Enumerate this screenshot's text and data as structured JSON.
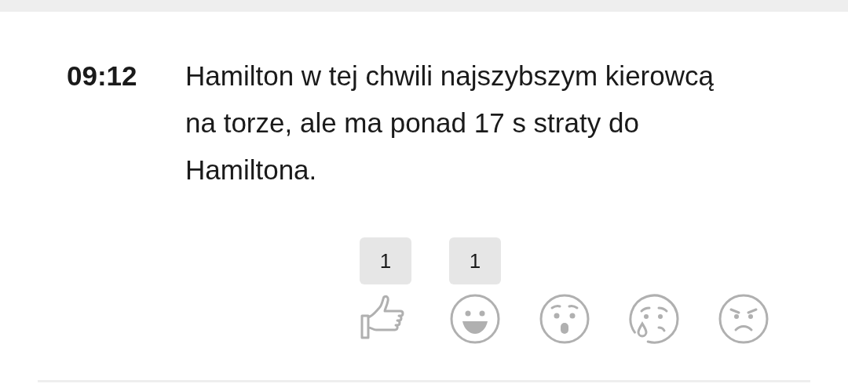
{
  "entry": {
    "time": "09:12",
    "text": "Hamilton w tej chwili najszybszym kierowcą na torze, ale ma ponad 17 s straty do Hamiltona."
  },
  "reactions": [
    {
      "kind": "like",
      "count": "1"
    },
    {
      "kind": "laugh",
      "count": "1"
    },
    {
      "kind": "wow"
    },
    {
      "kind": "sad"
    },
    {
      "kind": "angry"
    }
  ]
}
